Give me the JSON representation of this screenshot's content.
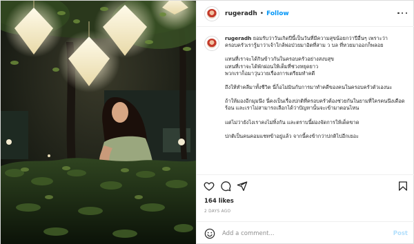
{
  "user": {
    "username": "rugeradh",
    "separator": "•",
    "follow_label": "Follow"
  },
  "caption": {
    "username": "rugeradh",
    "paragraphs": [
      "ยอมรับว่าวันเกิดปีนี้เป็นวันที่มีความสุขน้อยกว่าปีอื่นๆ เพราะว่าครอบครัวเรารู้มาว่าเจ้าใกล้พ่อป่วยมาอิตที่สาม ว บล ที่หวยมาออกก็พลอย",
      "แทนที่เราจะได้กินข้าวกันในครอบครัวอย่างสงบสุข\nแทนที่เราจะได้พักผ่อนให้เต็มที่ช่วงหยุดยาว\nพวกเราก็อมาวุ่นวายเรื่องการเตรียมทำคดี",
      "ถึงให้ทำคลีมาทั้งชีวิต นี่ก็อไม่มินกับการมาทำคดีของคนในครอบครัวตัวเองนะ",
      "ถ้าให้มองอีกมุมนึง นี่คงเป็นเรื่องปกติที่ครอบครัวต้องช่วยกันในยามที่ใครคนนึงเดือดร้อน และเราไม่สามารถเลือกได้ว่าปัญหานั้นจะเข้ามาตอนไหน",
      "แต่ไม่ว่ายังไงเราคงไม่ทิ้งกัน และตราบนี้ผ่องจัดการให้เด็ดขาด",
      "ปกติเป็นคนคอมแชทข้าอยู่แล้ว จากนี้คงข้ากว่าปกติไปอีกเยอะ"
    ]
  },
  "actions": {
    "like_icon": "heart-icon",
    "comment_icon": "comment-bubble-icon",
    "share_icon": "paper-plane-icon",
    "save_icon": "bookmark-icon"
  },
  "stats": {
    "likes": "164 likes",
    "date": "2 DAYS AGO"
  },
  "comment_box": {
    "emoji_icon": "smiley-icon",
    "placeholder": "Add a comment...",
    "post_label": "Post"
  },
  "colors": {
    "follow": "#0095f6",
    "post_disabled": "#b2dffc",
    "muted": "#8e8e8e",
    "text": "#262626"
  }
}
